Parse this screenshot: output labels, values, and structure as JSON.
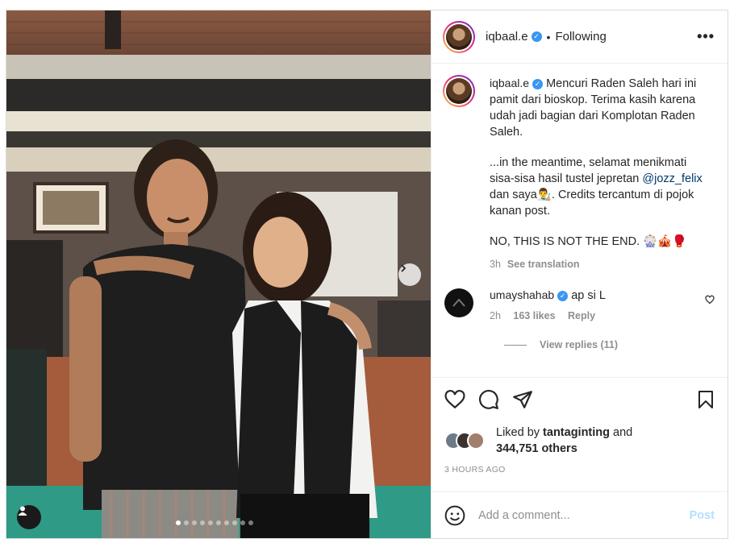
{
  "header": {
    "username": "iqbaal.e",
    "separator": "•",
    "follow_status": "Following",
    "more_icon": "more-horizontal-icon"
  },
  "caption": {
    "username": "iqbaal.e",
    "paragraph1": "Mencuri Raden Saleh hari ini pamit dari bioskop. Terima kasih karena udah jadi bagian dari Komplotan Raden Saleh.",
    "paragraph2_before": "...in the meantime, selamat menikmati sisa-sisa hasil tustel jepretan ",
    "mention": "@jozz_felix",
    "paragraph2_after": " dan saya👨‍🎨. Credits tercantum di pojok kanan post.",
    "paragraph3": "NO, THIS IS NOT THE END. 🎡🎪🥊",
    "time": "3h",
    "see_translation": "See translation"
  },
  "comment": {
    "username": "umayshahab",
    "text": "ap si L",
    "time": "2h",
    "likes": "163 likes",
    "reply": "Reply",
    "view_replies": "View replies (11)"
  },
  "actions": {
    "liked_by_prefix": "Liked by ",
    "liked_by_user": "tantaginting",
    "liked_by_mid": " and",
    "others": "344,751 others",
    "time_ago": "3 HOURS AGO"
  },
  "add_comment": {
    "placeholder": "Add a comment...",
    "post_label": "Post"
  },
  "carousel": {
    "total": 10,
    "active_index": 0
  },
  "icons": [
    "heart-icon",
    "comment-icon",
    "share-icon",
    "save-icon",
    "emoji-icon",
    "user-tag-icon",
    "chevron-right-icon"
  ]
}
